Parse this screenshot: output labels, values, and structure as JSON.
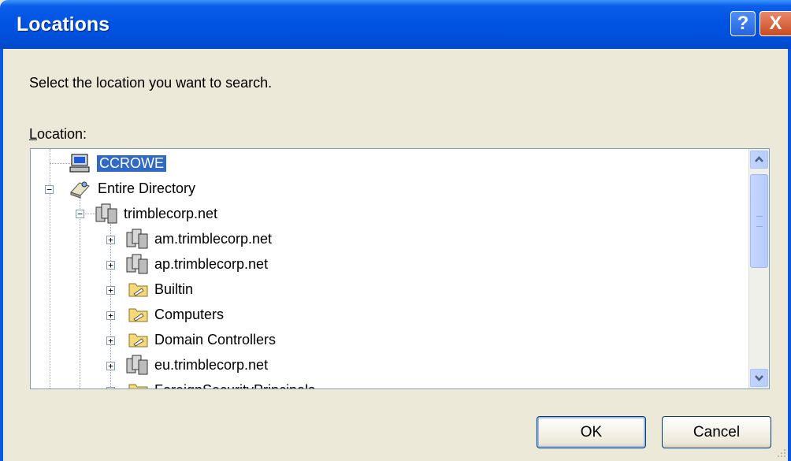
{
  "window": {
    "title": "Locations"
  },
  "titlebar_buttons": {
    "help": "?",
    "close": "X"
  },
  "instruction": "Select the location you want to search.",
  "location_label": {
    "accel": "L",
    "rest": "ocation:"
  },
  "tree": {
    "items": [
      {
        "label": "CCROWE",
        "selected": true,
        "icon": "computer-icon",
        "expander": ""
      },
      {
        "label": "Entire Directory",
        "icon": "directory-icon",
        "expander": "−"
      },
      {
        "label": "trimblecorp.net",
        "icon": "domain-icon",
        "expander": "−"
      },
      {
        "label": "am.trimblecorp.net",
        "icon": "domain-icon",
        "expander": "+"
      },
      {
        "label": "ap.trimblecorp.net",
        "icon": "domain-icon",
        "expander": "+"
      },
      {
        "label": "Builtin",
        "icon": "folder-icon",
        "expander": "+"
      },
      {
        "label": "Computers",
        "icon": "folder-icon",
        "expander": "+"
      },
      {
        "label": "Domain Controllers",
        "icon": "folder-icon",
        "expander": "+"
      },
      {
        "label": "eu.trimblecorp.net",
        "icon": "domain-icon",
        "expander": "+"
      },
      {
        "label": "ForeignSecurityPrincipals",
        "icon": "folder-icon",
        "expander": "+"
      }
    ]
  },
  "buttons": {
    "ok": "OK",
    "cancel": "Cancel"
  },
  "colors": {
    "titlebar": "#0054e3",
    "selection": "#316ac5",
    "dialog": "#ece9d8"
  }
}
